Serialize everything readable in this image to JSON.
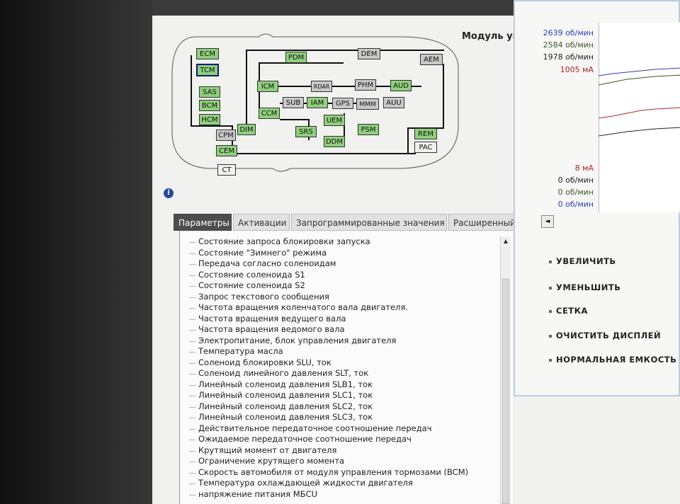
{
  "module_title": "Модуль упра",
  "info_icon_glyph": "i",
  "diagram": {
    "nodes": {
      "ecm": "ECM",
      "tcm": "TCM",
      "sas": "SAS",
      "bcm": "BCM",
      "hcm": "HCM",
      "cpm": "CPM",
      "cem": "CEM",
      "ct": "CT",
      "dim": "DIM",
      "pdm": "PDM",
      "dem": "DEM",
      "aem": "AEM",
      "icm": "ICM",
      "rdar": "RDAR",
      "phm": "PHM",
      "aud": "AUD",
      "sub": "SUB",
      "iam": "IAM",
      "gps": "GPS",
      "mmm": "MMM",
      "auu": "AUU",
      "ccm": "CCM",
      "srs": "SRS",
      "uem": "UEM",
      "ddm": "DDM",
      "psm": "PSM",
      "rem": "REM",
      "pac": "PAC"
    }
  },
  "tabs": [
    "Параметры",
    "Активации",
    "Запрограммированные значения",
    "Расширенный"
  ],
  "parameters": [
    "Состояние запроса блокировки запуска",
    "Состояние \"Зимнего\" режима",
    "Передача согласно соленоидам",
    "Состояние соленоида S1",
    "Состояние соленоида S2",
    "Запрос текстового сообщения",
    "Частота вращения коленчатого вала двигателя.",
    "Частота вращения ведущего вала",
    "Частота вращения ведомого вала",
    "Электропитание, блок управления двигателя",
    "Температура масла",
    "Соленоид блокировки SLU, ток",
    "Соленоид линейного давления SLT, ток",
    "Линейный соленоид давления SLB1, ток",
    "Линейный соленоид давления SLC1, ток",
    "Линейный соленоид давления SLC2, ток",
    "Линейный соленоид давления SLC3, ток",
    "Действительное передаточное соотношение передач",
    "Ожидаемое передаточное соотношение передач",
    "Крутящий момент от двигателя",
    "Ограничение крутящего момента",
    "Скорость автомобиля от модуля управления тормозами (BCM)",
    "Температура охлаждающей жидкости двигателя",
    "напряжение питания МБСU"
  ],
  "graph": {
    "readings_top": [
      {
        "text": "2639 об/мин",
        "color": "#2b3fb5"
      },
      {
        "text": "2584 об/мин",
        "color": "#3c5a28"
      },
      {
        "text": "1978 об/мин",
        "color": "#222222"
      },
      {
        "text": "1005 мА",
        "color": "#b02424"
      }
    ],
    "readings_bottom": [
      {
        "text": "8 мА",
        "color": "#b02424"
      },
      {
        "text": "0 об/мин",
        "color": "#222222"
      },
      {
        "text": "0 об/мин",
        "color": "#3c5a28"
      },
      {
        "text": "0 об/мин",
        "color": "#2b3fb5"
      }
    ],
    "scroll_left_glyph": "◄"
  },
  "controls": {
    "zoom_in": "УВЕЛИЧИТЬ",
    "zoom_out": "УМЕНЬШИТЬ",
    "grid": "СЕТКА",
    "clear_display": "ОЧИСТИТЬ ДИСПЛЕЙ",
    "normal_capacity": "НОРМАЛЬНАЯ ЕМКОСТЬ"
  },
  "colors": {
    "node_green": "#8fd07c",
    "node_grey": "#c9c9c9",
    "active_tab": "#4d4d4d",
    "graph_frame": "#b9cfe1"
  }
}
